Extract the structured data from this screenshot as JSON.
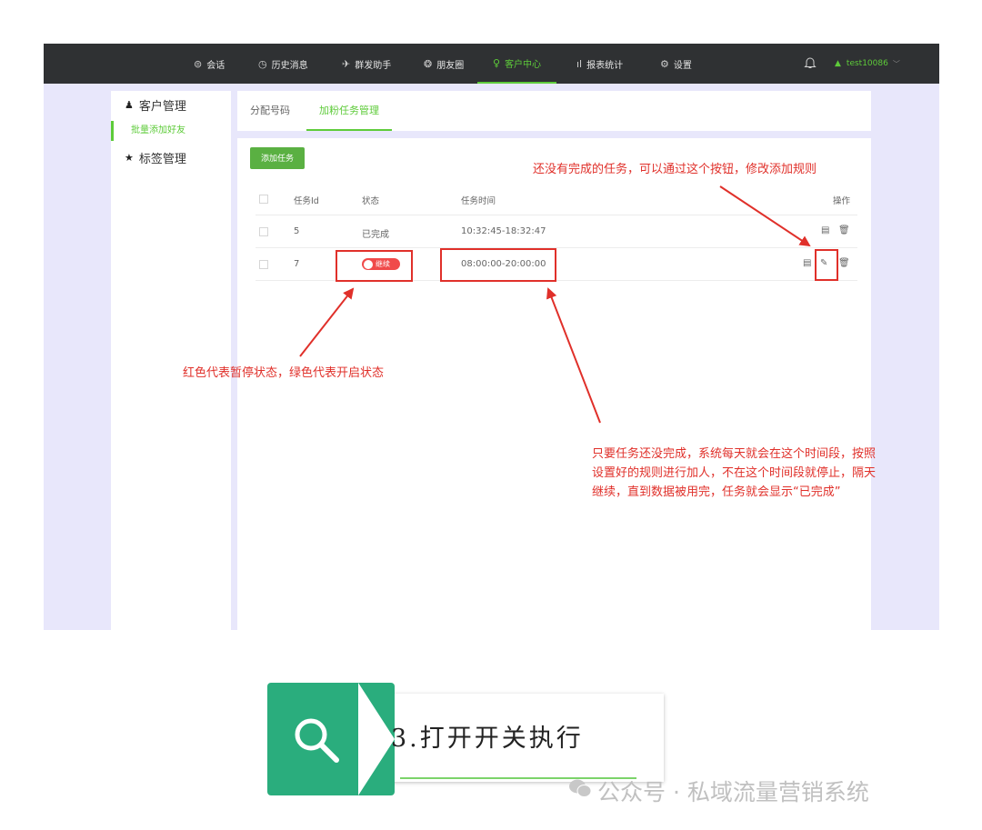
{
  "nav": {
    "items": [
      {
        "icon": "chat-icon",
        "glyph": "⊜",
        "label": "会话"
      },
      {
        "icon": "clock-icon",
        "glyph": "◷",
        "label": "历史消息"
      },
      {
        "icon": "send-icon",
        "glyph": "✈",
        "label": "群发助手"
      },
      {
        "icon": "moments-icon",
        "glyph": "❂",
        "label": "朋友圈"
      },
      {
        "icon": "person-icon",
        "glyph": "♀",
        "label": "客户中心"
      },
      {
        "icon": "bar-chart-icon",
        "glyph": "ıl",
        "label": "报表统计"
      },
      {
        "icon": "gear-icon",
        "glyph": "⚙",
        "label": "设置"
      }
    ],
    "active": "客户中心",
    "user": "test10086"
  },
  "sidebar": {
    "customer_mgmt": "客户管理",
    "batch_add": "批量添加好友",
    "tag_mgmt": "标签管理"
  },
  "tabs": {
    "assign": "分配号码",
    "tasks": "加粉任务管理"
  },
  "table": {
    "add_button": "添加任务",
    "headers": {
      "id": "任务Id",
      "status": "状态",
      "time": "任务时间",
      "ops": "操作"
    },
    "rows": [
      {
        "id": "5",
        "status": "已完成",
        "time": "10:32:45-18:32:47"
      },
      {
        "id": "7",
        "status": "继续",
        "time": "08:00:00-20:00:00"
      }
    ]
  },
  "notes": {
    "edit_hint": "还没有完成的任务，可以通过这个按钮，修改添加规则",
    "status_hint": "红色代表暂停状态，绿色代表开启状态",
    "time_hint_1": "只要任务还没完成，系统每天就会在这个时间段，按照",
    "time_hint_2": "设置好的规则进行加人，不在这个时间段就停止，隔天",
    "time_hint_3": "继续，直到数据被用完，任务就会显示“已完成”"
  },
  "banner": {
    "step": "3.打开开关执行"
  },
  "watermark": "公众号 · 私域流量营销系统",
  "colors": {
    "accent": "#5ecb3a",
    "annotation": "#e0302a",
    "banner": "#2aad7d",
    "toggle_off": "#f04a4a"
  }
}
